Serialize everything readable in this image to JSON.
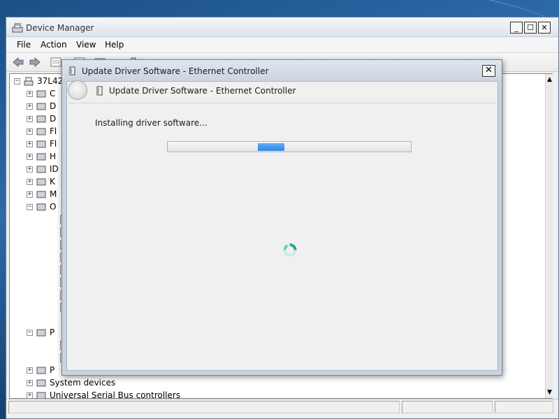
{
  "device_manager": {
    "title": "Device Manager",
    "caption_buttons": {
      "minimize": "_",
      "maximize": "☐",
      "close": "✕"
    },
    "menu": [
      "File",
      "Action",
      "View",
      "Help"
    ],
    "tree": {
      "root_label": "37L42",
      "rows": [
        {
          "label": "C",
          "expander": "+",
          "icon": "computer-icon"
        },
        {
          "label": "D",
          "expander": "+",
          "icon": "disk-drive-icon"
        },
        {
          "label": "D",
          "expander": "+",
          "icon": "display-adapter-icon"
        },
        {
          "label": "Fl",
          "expander": "+",
          "icon": "floppy-disk-icon"
        },
        {
          "label": "Fl",
          "expander": "+",
          "icon": "floppy-controller-icon"
        },
        {
          "label": "H",
          "expander": "+",
          "icon": "hid-icon"
        },
        {
          "label": "ID",
          "expander": "+",
          "icon": "ide-controller-icon"
        },
        {
          "label": "K",
          "expander": "+",
          "icon": "keyboard-icon"
        },
        {
          "label": "M",
          "expander": "+",
          "icon": "mouse-icon"
        },
        {
          "label": "O",
          "expander": "−",
          "icon": "other-devices-icon"
        },
        {
          "label": "P",
          "expander": "−",
          "icon": "port-icon"
        },
        {
          "label": "P",
          "expander": "+",
          "icon": "processor-icon"
        },
        {
          "label": "System devices",
          "expander": "+",
          "icon": "system-devices-icon"
        },
        {
          "label": "Universal Serial Bus controllers",
          "expander": "+",
          "icon": "usb-icon"
        }
      ]
    }
  },
  "dialog": {
    "title": "Update Driver Software - Ethernet Controller",
    "header": "Update Driver Software - Ethernet Controller",
    "status": "Installing driver software...",
    "close_symbol": "✕",
    "progress_fraction": 0.37,
    "accent_color": "#2b86e6"
  }
}
